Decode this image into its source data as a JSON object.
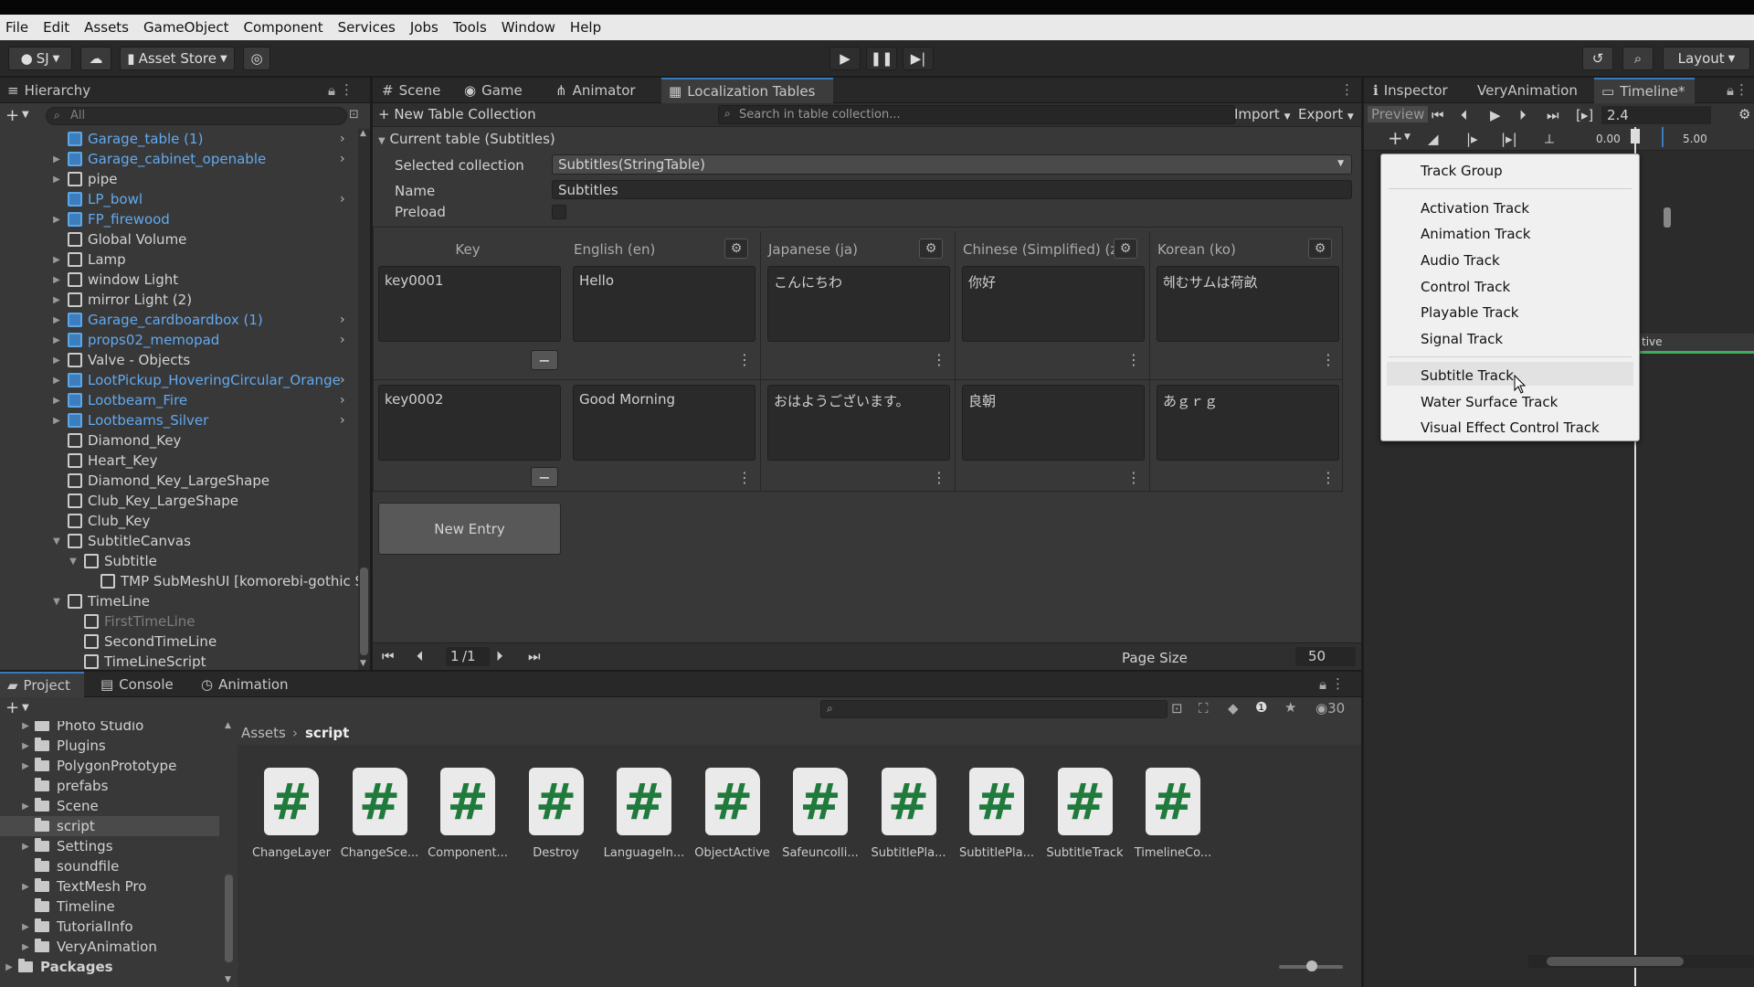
{
  "menu": [
    "File",
    "Edit",
    "Assets",
    "GameObject",
    "Component",
    "Services",
    "Jobs",
    "Tools",
    "Window",
    "Help"
  ],
  "toolbar": {
    "account": "SJ",
    "asset_store": "Asset Store",
    "layout": "Layout"
  },
  "hierarchy": {
    "tab": "Hierarchy",
    "search_placeholder": "All",
    "items": [
      {
        "label": "Garage_table (1)",
        "prefab": true,
        "arrow": false,
        "chev": true,
        "indent": 0
      },
      {
        "label": "Garage_cabinet_openable",
        "prefab": true,
        "arrow": true,
        "chev": true,
        "indent": 0
      },
      {
        "label": "pipe",
        "prefab": false,
        "arrow": true,
        "chev": false,
        "indent": 0
      },
      {
        "label": "LP_bowl",
        "prefab": true,
        "arrow": false,
        "chev": true,
        "indent": 0
      },
      {
        "label": "FP_firewood",
        "prefab": true,
        "arrow": true,
        "chev": false,
        "indent": 0
      },
      {
        "label": "Global Volume",
        "prefab": false,
        "arrow": false,
        "chev": false,
        "indent": 0
      },
      {
        "label": "Lamp",
        "prefab": false,
        "arrow": true,
        "chev": false,
        "indent": 0
      },
      {
        "label": "window Light",
        "prefab": false,
        "arrow": true,
        "chev": false,
        "indent": 0
      },
      {
        "label": "mirror Light (2)",
        "prefab": false,
        "arrow": true,
        "chev": false,
        "indent": 0
      },
      {
        "label": "Garage_cardboardbox (1)",
        "prefab": true,
        "arrow": true,
        "chev": true,
        "indent": 0
      },
      {
        "label": "props02_memopad",
        "prefab": true,
        "arrow": true,
        "chev": true,
        "indent": 0
      },
      {
        "label": "Valve - Objects",
        "prefab": false,
        "arrow": true,
        "chev": false,
        "indent": 0
      },
      {
        "label": "LootPickup_HoveringCircular_Orange",
        "prefab": true,
        "arrow": true,
        "chev": true,
        "indent": 0
      },
      {
        "label": "Lootbeam_Fire",
        "prefab": true,
        "arrow": true,
        "chev": true,
        "indent": 0
      },
      {
        "label": "Lootbeams_Silver",
        "prefab": true,
        "arrow": true,
        "chev": true,
        "indent": 0
      },
      {
        "label": "Diamond_Key",
        "prefab": false,
        "arrow": false,
        "chev": false,
        "indent": 0
      },
      {
        "label": "Heart_Key",
        "prefab": false,
        "arrow": false,
        "chev": false,
        "indent": 0
      },
      {
        "label": "Diamond_Key_LargeShape",
        "prefab": false,
        "arrow": false,
        "chev": false,
        "indent": 0
      },
      {
        "label": "Club_Key_LargeShape",
        "prefab": false,
        "arrow": false,
        "chev": false,
        "indent": 0
      },
      {
        "label": "Club_Key",
        "prefab": false,
        "arrow": false,
        "chev": false,
        "indent": 0
      },
      {
        "label": "SubtitleCanvas",
        "prefab": false,
        "arrow": true,
        "chev": false,
        "indent": 0,
        "open": true
      },
      {
        "label": "Subtitle",
        "prefab": false,
        "arrow": true,
        "chev": false,
        "indent": 1,
        "open": true
      },
      {
        "label": "TMP SubMeshUI [komorebi-gothic S",
        "prefab": false,
        "arrow": false,
        "chev": false,
        "indent": 2
      },
      {
        "label": "TimeLine",
        "prefab": false,
        "arrow": true,
        "chev": false,
        "indent": 0,
        "open": true
      },
      {
        "label": "FirstTimeLine",
        "prefab": false,
        "arrow": false,
        "chev": false,
        "indent": 1,
        "dim": true
      },
      {
        "label": "SecondTimeLine",
        "prefab": false,
        "arrow": false,
        "chev": false,
        "indent": 1
      },
      {
        "label": "TimeLineScript",
        "prefab": false,
        "arrow": false,
        "chev": false,
        "indent": 1
      }
    ]
  },
  "center_tabs": [
    "Scene",
    "Game",
    "Animator",
    "Localization Tables"
  ],
  "localization": {
    "new_collection": "+ New Table Collection",
    "search_placeholder": "Search in table collection...",
    "import": "Import",
    "export": "Export",
    "current_table": "Current table (Subtitles)",
    "selected_collection_label": "Selected collection",
    "selected_collection_value": "Subtitles(StringTable)",
    "name_label": "Name",
    "name_value": "Subtitles",
    "preload_label": "Preload",
    "columns": [
      "Key",
      "English (en)",
      "Japanese (ja)",
      "Chinese (Simplified) (z",
      "Korean (ko)"
    ],
    "rows": [
      {
        "key": "key0001",
        "values": [
          "Hello",
          "こんにちわ",
          "你好",
          "헤むサムは荷畝"
        ]
      },
      {
        "key": "key0002",
        "values": [
          "Good Morning",
          "おはようございます。",
          "良朝",
          "あｇｒｇ"
        ]
      }
    ],
    "new_entry": "New Entry",
    "page_current": "1",
    "page_total": "/1",
    "page_size_label": "Page Size",
    "page_size_value": "50"
  },
  "right_tabs": [
    "Inspector",
    "VeryAnimation",
    "Timeline*"
  ],
  "timeline": {
    "preview": "Preview",
    "frame": "2.4",
    "ruler_start": "0.00",
    "ruler_mid": "5.00",
    "clip_text": "tive"
  },
  "context_menu": {
    "items": [
      "Track Group",
      "Activation Track",
      "Animation Track",
      "Audio Track",
      "Control Track",
      "Playable Track",
      "Signal Track",
      "Subtitle Track",
      "Water Surface Track",
      "Visual Effect Control Track"
    ]
  },
  "bottom_tabs": [
    "Project",
    "Console",
    "Animation"
  ],
  "project": {
    "folders": [
      "Photo Studio",
      "Plugins",
      "PolygonPrototype",
      "prefabs",
      "Scene",
      "script",
      "Settings",
      "soundfile",
      "TextMesh Pro",
      "Timeline",
      "TutorialInfo",
      "VeryAnimation",
      "Packages"
    ],
    "breadcrumb_root": "Assets",
    "breadcrumb_current": "script",
    "count": "30",
    "assets": [
      "ChangeLayer",
      "ChangeSce...",
      "Component...",
      "Destroy",
      "LanguageIn...",
      "ObjectActive",
      "Safeuncolli...",
      "SubtitlePla...",
      "SubtitlePla...",
      "SubtitleTrack",
      "TimelineCo..."
    ]
  }
}
